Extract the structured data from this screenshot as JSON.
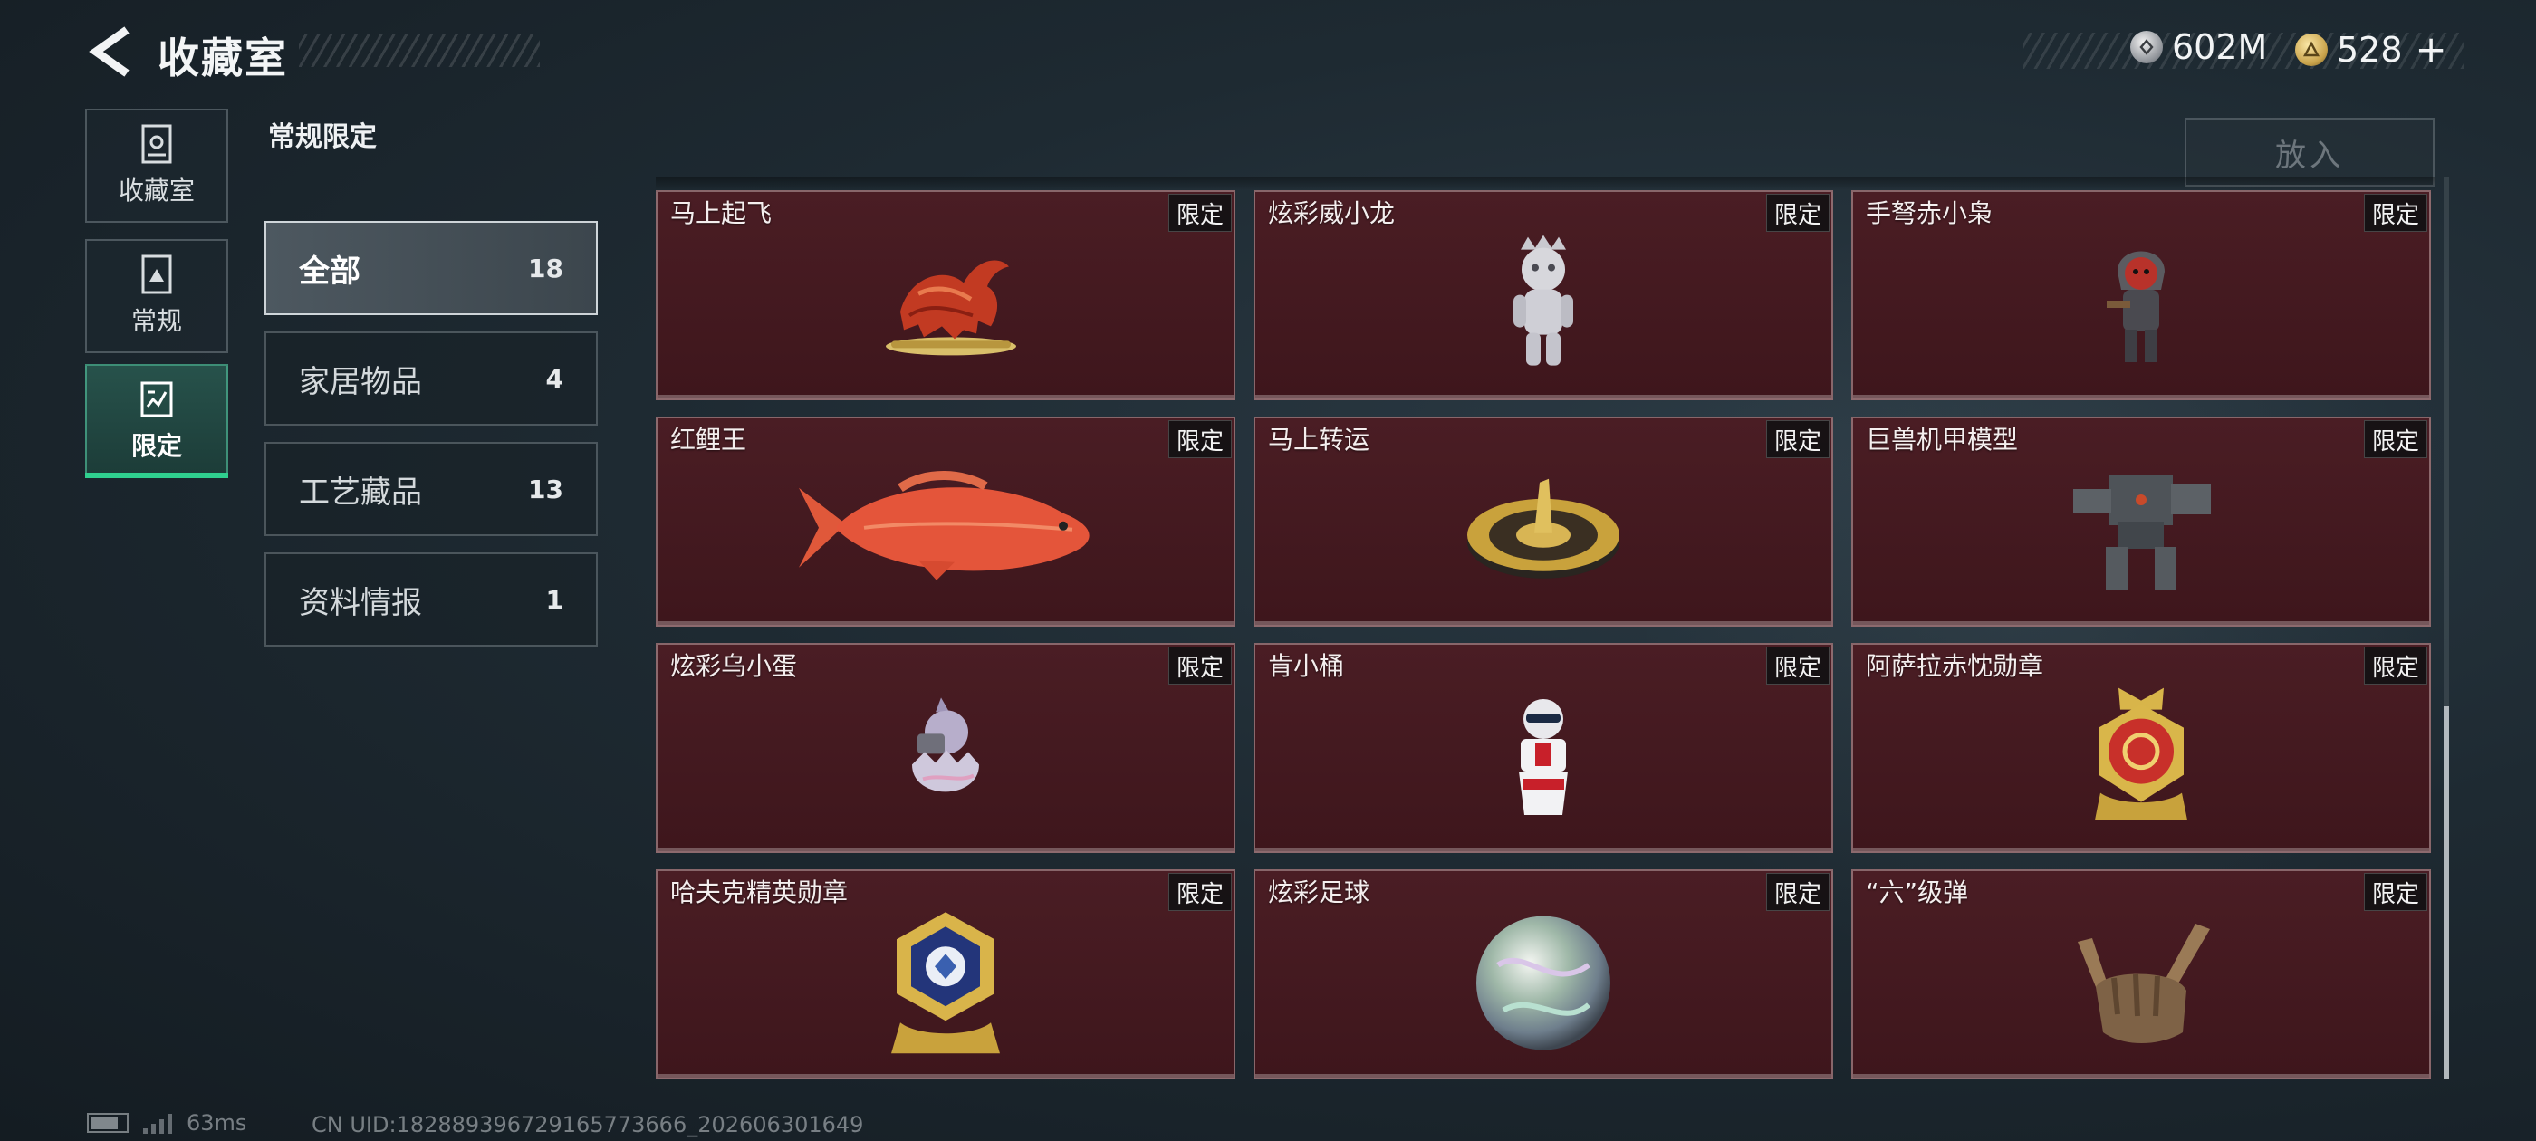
{
  "header": {
    "title": "收藏室",
    "currencies": [
      {
        "name": "silver",
        "value": "602M",
        "icon": "silver-coin-icon"
      },
      {
        "name": "gold",
        "value": "528",
        "icon": "gold-coin-icon",
        "plus": "+"
      }
    ]
  },
  "nav": {
    "items": [
      {
        "label": "收藏室",
        "icon": "collection-room-icon"
      },
      {
        "label": "常规",
        "icon": "regular-icon"
      },
      {
        "label": "限定",
        "icon": "limited-icon",
        "active": true
      }
    ]
  },
  "section_label": "常规限定",
  "filters": [
    {
      "name": "全部",
      "count": "18",
      "active": true
    },
    {
      "name": "家居物品",
      "count": "4"
    },
    {
      "name": "工艺藏品",
      "count": "13"
    },
    {
      "name": "资料情报",
      "count": "1"
    }
  ],
  "put_button": "放入",
  "items": [
    {
      "name": "马上起飞",
      "tag": "限定",
      "icon": "horse-statue-icon"
    },
    {
      "name": "炫彩威小龙",
      "tag": "限定",
      "icon": "dragon-figure-icon"
    },
    {
      "name": "手弩赤小枭",
      "tag": "限定",
      "icon": "hooded-figure-icon"
    },
    {
      "name": "红鲤王",
      "tag": "限定",
      "icon": "red-carp-icon"
    },
    {
      "name": "马上转运",
      "tag": "限定",
      "icon": "golden-spinner-icon"
    },
    {
      "name": "巨兽机甲模型",
      "tag": "限定",
      "icon": "mech-model-icon"
    },
    {
      "name": "炫彩乌小蛋",
      "tag": "限定",
      "icon": "egg-figure-icon"
    },
    {
      "name": "肯小桶",
      "tag": "限定",
      "icon": "bucket-figure-icon"
    },
    {
      "name": "阿萨拉赤忱勋章",
      "tag": "限定",
      "icon": "red-medal-icon"
    },
    {
      "name": "哈夫克精英勋章",
      "tag": "限定",
      "icon": "blue-medal-icon"
    },
    {
      "name": "炫彩足球",
      "tag": "限定",
      "icon": "iridescent-ball-icon"
    },
    {
      "name": "“六”级弹",
      "tag": "限定",
      "icon": "hand-sign-icon"
    }
  ],
  "status": {
    "latency": "63ms",
    "uid": "CN UID:182889396729165773666_202606301649"
  },
  "colors": {
    "accent": "#2fd08f",
    "card_bg": "#451a21"
  }
}
